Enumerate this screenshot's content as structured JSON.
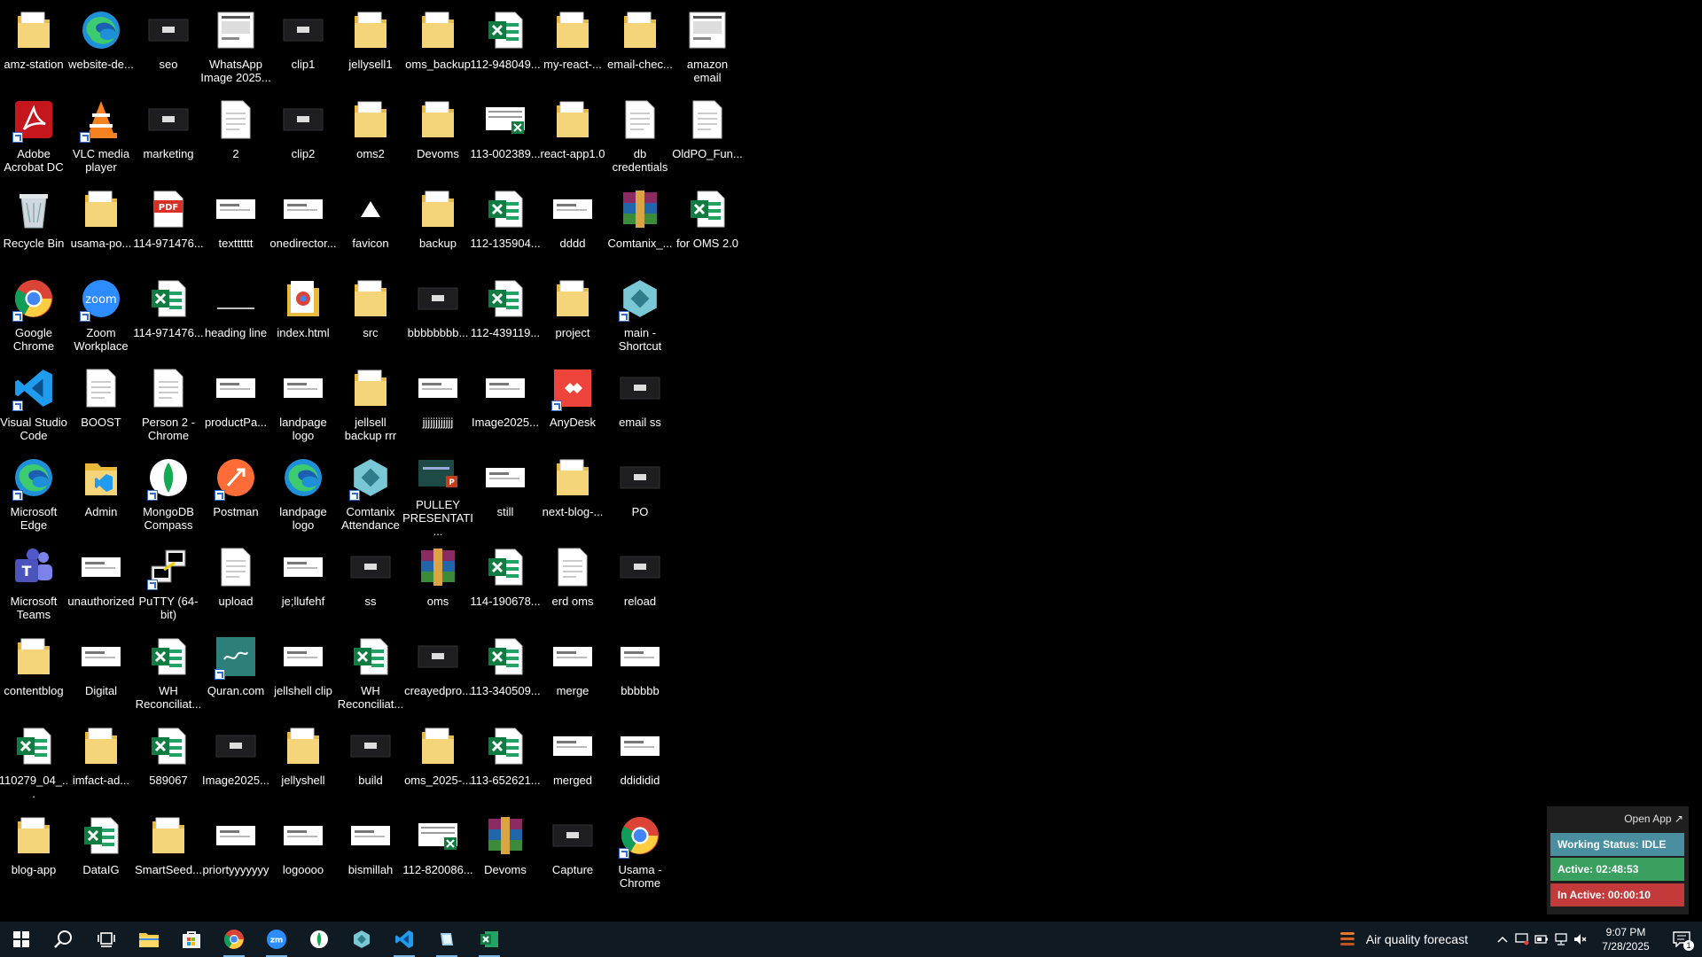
{
  "desktop_icons": [
    {
      "label": "amz-station",
      "icon": "folder",
      "c": 0,
      "r": 0
    },
    {
      "label": "website-de...",
      "icon": "edge",
      "c": 1,
      "r": 0
    },
    {
      "label": "seo",
      "icon": "image-dark",
      "c": 2,
      "r": 0
    },
    {
      "label": "WhatsApp Image 2025...",
      "icon": "doc-image",
      "c": 3,
      "r": 0
    },
    {
      "label": "clip1",
      "icon": "image-dark",
      "c": 4,
      "r": 0
    },
    {
      "label": "jellysell1",
      "icon": "folder",
      "c": 5,
      "r": 0
    },
    {
      "label": "oms_backup",
      "icon": "folder",
      "c": 6,
      "r": 0
    },
    {
      "label": "112-948049...",
      "icon": "excel",
      "c": 7,
      "r": 0
    },
    {
      "label": "my-react-...",
      "icon": "folder",
      "c": 8,
      "r": 0
    },
    {
      "label": "email-chec...",
      "icon": "folder",
      "c": 9,
      "r": 0
    },
    {
      "label": "amazon email",
      "icon": "doc-image",
      "c": 10,
      "r": 0
    },
    {
      "label": "Adobe Acrobat DC",
      "icon": "acrobat",
      "c": 0,
      "r": 1,
      "shortcut": true
    },
    {
      "label": "VLC media player",
      "icon": "vlc",
      "c": 1,
      "r": 1,
      "shortcut": true
    },
    {
      "label": "marketing",
      "icon": "image-dark",
      "c": 2,
      "r": 1
    },
    {
      "label": "2",
      "icon": "document",
      "c": 3,
      "r": 1
    },
    {
      "label": "clip2",
      "icon": "image-dark",
      "c": 4,
      "r": 1
    },
    {
      "label": "oms2",
      "icon": "folder",
      "c": 5,
      "r": 1
    },
    {
      "label": "Devoms",
      "icon": "folder",
      "c": 6,
      "r": 1
    },
    {
      "label": "113-002389...",
      "icon": "excel-image",
      "c": 7,
      "r": 1
    },
    {
      "label": "react-app1.0",
      "icon": "folder",
      "c": 8,
      "r": 1
    },
    {
      "label": "db credentials",
      "icon": "document",
      "c": 9,
      "r": 1
    },
    {
      "label": "OldPO_Fun...",
      "icon": "document",
      "c": 10,
      "r": 1
    },
    {
      "label": "Recycle Bin",
      "icon": "recycle",
      "c": 0,
      "r": 2
    },
    {
      "label": "usama-po...",
      "icon": "folder",
      "c": 1,
      "r": 2
    },
    {
      "label": "114-971476...",
      "icon": "pdf",
      "c": 2,
      "r": 2
    },
    {
      "label": "textttttt",
      "icon": "image-white",
      "c": 3,
      "r": 2
    },
    {
      "label": "onedirector...",
      "icon": "image-white",
      "c": 4,
      "r": 2
    },
    {
      "label": "favicon",
      "icon": "triangle",
      "c": 5,
      "r": 2
    },
    {
      "label": "backup",
      "icon": "folder",
      "c": 6,
      "r": 2
    },
    {
      "label": "112-135904...",
      "icon": "excel",
      "c": 7,
      "r": 2
    },
    {
      "label": "dddd",
      "icon": "image-white",
      "c": 8,
      "r": 2
    },
    {
      "label": "Comtanix_...",
      "icon": "winrar",
      "c": 9,
      "r": 2
    },
    {
      "label": "for OMS 2.0",
      "icon": "excel",
      "c": 10,
      "r": 2
    },
    {
      "label": "Google Chrome",
      "icon": "chrome",
      "c": 0,
      "r": 3,
      "shortcut": true
    },
    {
      "label": "Zoom Workplace",
      "icon": "zoom",
      "c": 1,
      "r": 3,
      "shortcut": true
    },
    {
      "label": "114-971476...",
      "icon": "excel",
      "c": 2,
      "r": 3
    },
    {
      "label": "heading line",
      "icon": "line",
      "c": 3,
      "r": 3
    },
    {
      "label": "index.html",
      "icon": "chrome-doc",
      "c": 4,
      "r": 3
    },
    {
      "label": "src",
      "icon": "folder",
      "c": 5,
      "r": 3
    },
    {
      "label": "bbbbbbbb...",
      "icon": "image-dark",
      "c": 6,
      "r": 3
    },
    {
      "label": "112-439119...",
      "icon": "excel",
      "c": 7,
      "r": 3
    },
    {
      "label": "project",
      "icon": "folder",
      "c": 8,
      "r": 3
    },
    {
      "label": "main - Shortcut",
      "icon": "comtanix",
      "c": 9,
      "r": 3,
      "shortcut": true
    },
    {
      "label": "Visual Studio Code",
      "icon": "vscode",
      "c": 0,
      "r": 4,
      "shortcut": true
    },
    {
      "label": "BOOST",
      "icon": "document",
      "c": 1,
      "r": 4
    },
    {
      "label": "Person 2 - Chrome",
      "icon": "document",
      "c": 2,
      "r": 4
    },
    {
      "label": "productPa...",
      "icon": "image-white",
      "c": 3,
      "r": 4
    },
    {
      "label": "landpage logo",
      "icon": "image-white",
      "c": 4,
      "r": 4
    },
    {
      "label": "jellsell backup rrr",
      "icon": "folder",
      "c": 5,
      "r": 4
    },
    {
      "label": "jjjjjjjjjjjj",
      "icon": "image-white",
      "c": 6,
      "r": 4
    },
    {
      "label": "Image2025...",
      "icon": "image-white",
      "c": 7,
      "r": 4
    },
    {
      "label": "AnyDesk",
      "icon": "anydesk",
      "c": 8,
      "r": 4,
      "shortcut": true
    },
    {
      "label": "email ss",
      "icon": "image-dark",
      "c": 9,
      "r": 4
    },
    {
      "label": "Microsoft Edge",
      "icon": "edge",
      "c": 0,
      "r": 5,
      "shortcut": true
    },
    {
      "label": "Admin",
      "icon": "folder-vs",
      "c": 1,
      "r": 5
    },
    {
      "label": "MongoDB Compass",
      "icon": "mongodb",
      "c": 2,
      "r": 5,
      "shortcut": true
    },
    {
      "label": "Postman",
      "icon": "postman",
      "c": 3,
      "r": 5,
      "shortcut": true
    },
    {
      "label": "landpage logo",
      "icon": "edge",
      "c": 4,
      "r": 5
    },
    {
      "label": "Comtanix Attendance",
      "icon": "comtanix",
      "c": 5,
      "r": 5,
      "shortcut": true
    },
    {
      "label": "PULLEY PRESENTATI...",
      "icon": "ppt",
      "c": 6,
      "r": 5
    },
    {
      "label": "still",
      "icon": "image-white",
      "c": 7,
      "r": 5
    },
    {
      "label": "next-blog-...",
      "icon": "folder",
      "c": 8,
      "r": 5
    },
    {
      "label": "PO",
      "icon": "image-dark",
      "c": 9,
      "r": 5
    },
    {
      "label": "Microsoft Teams",
      "icon": "teams",
      "c": 0,
      "r": 6
    },
    {
      "label": "unauthorized",
      "icon": "image-white",
      "c": 1,
      "r": 6
    },
    {
      "label": "PuTTY (64-bit)",
      "icon": "putty",
      "c": 2,
      "r": 6,
      "shortcut": true
    },
    {
      "label": "upload",
      "icon": "document",
      "c": 3,
      "r": 6
    },
    {
      "label": "je;llufehf",
      "icon": "image-white",
      "c": 4,
      "r": 6
    },
    {
      "label": "ss",
      "icon": "image-dark",
      "c": 5,
      "r": 6
    },
    {
      "label": "oms",
      "icon": "winrar",
      "c": 6,
      "r": 6
    },
    {
      "label": "114-190678...",
      "icon": "excel",
      "c": 7,
      "r": 6
    },
    {
      "label": "erd oms",
      "icon": "document",
      "c": 8,
      "r": 6
    },
    {
      "label": "reload",
      "icon": "image-dark",
      "c": 9,
      "r": 6
    },
    {
      "label": "contentblog",
      "icon": "folder",
      "c": 0,
      "r": 7
    },
    {
      "label": "Digital",
      "icon": "image-white",
      "c": 1,
      "r": 7
    },
    {
      "label": "WH Reconciliat...",
      "icon": "excel",
      "c": 2,
      "r": 7
    },
    {
      "label": "Quran.com",
      "icon": "quran",
      "c": 3,
      "r": 7,
      "shortcut": true
    },
    {
      "label": "jellshell clip",
      "icon": "image-white",
      "c": 4,
      "r": 7
    },
    {
      "label": "WH Reconciliat...",
      "icon": "excel",
      "c": 5,
      "r": 7
    },
    {
      "label": "creayedpro...",
      "icon": "image-dark",
      "c": 6,
      "r": 7
    },
    {
      "label": "113-340509...",
      "icon": "excel",
      "c": 7,
      "r": 7
    },
    {
      "label": "merge",
      "icon": "image-white",
      "c": 8,
      "r": 7
    },
    {
      "label": "bbbbbb",
      "icon": "image-white",
      "c": 9,
      "r": 7
    },
    {
      "label": "110279_04_...",
      "icon": "excel",
      "c": 0,
      "r": 8
    },
    {
      "label": "imfact-ad...",
      "icon": "folder",
      "c": 1,
      "r": 8
    },
    {
      "label": "589067",
      "icon": "excel",
      "c": 2,
      "r": 8
    },
    {
      "label": "Image2025...",
      "icon": "image-dark",
      "c": 3,
      "r": 8
    },
    {
      "label": "jellyshell",
      "icon": "folder",
      "c": 4,
      "r": 8
    },
    {
      "label": "build",
      "icon": "image-dark",
      "c": 5,
      "r": 8
    },
    {
      "label": "oms_2025-...",
      "icon": "folder",
      "c": 6,
      "r": 8
    },
    {
      "label": "113-652621...",
      "icon": "excel",
      "c": 7,
      "r": 8
    },
    {
      "label": "merged",
      "icon": "image-white",
      "c": 8,
      "r": 8
    },
    {
      "label": "ddididid",
      "icon": "image-white",
      "c": 9,
      "r": 8
    },
    {
      "label": "blog-app",
      "icon": "folder",
      "c": 0,
      "r": 9
    },
    {
      "label": "DataIG",
      "icon": "excel",
      "c": 1,
      "r": 9
    },
    {
      "label": "SmartSeed...",
      "icon": "folder",
      "c": 2,
      "r": 9
    },
    {
      "label": "priortyyyyyyy",
      "icon": "image-white",
      "c": 3,
      "r": 9
    },
    {
      "label": "logoooo",
      "icon": "image-white",
      "c": 4,
      "r": 9
    },
    {
      "label": "bismillah",
      "icon": "image-white",
      "c": 5,
      "r": 9
    },
    {
      "label": "112-820086...",
      "icon": "excel-image",
      "c": 6,
      "r": 9
    },
    {
      "label": "Devoms",
      "icon": "winrar",
      "c": 7,
      "r": 9
    },
    {
      "label": "Capture",
      "icon": "image-dark",
      "c": 8,
      "r": 9
    },
    {
      "label": "Usama - Chrome",
      "icon": "chrome",
      "c": 9,
      "r": 9,
      "shortcut": true
    }
  ],
  "tracker": {
    "open_app": "Open App ↗",
    "working_status": "Working Status: IDLE",
    "active": "Active: 02:48:53",
    "inactive": "In Active: 00:00:10",
    "colors": {
      "status": "#4a8fa0",
      "active": "#3aa060",
      "inactive": "#c23a3a"
    }
  },
  "taskbar": {
    "apps": [
      "start-icon",
      "search-icon",
      "task-view-icon",
      "file-explorer-icon",
      "store-icon",
      "chrome-icon",
      "zoom-icon",
      "mongodb-icon",
      "comtanix-icon",
      "vscode-icon",
      "snipping-icon",
      "excel-icon"
    ],
    "weather_text": "Air quality forecast",
    "time": "9:07 PM",
    "date": "7/28/2025",
    "notification_count": "1"
  }
}
